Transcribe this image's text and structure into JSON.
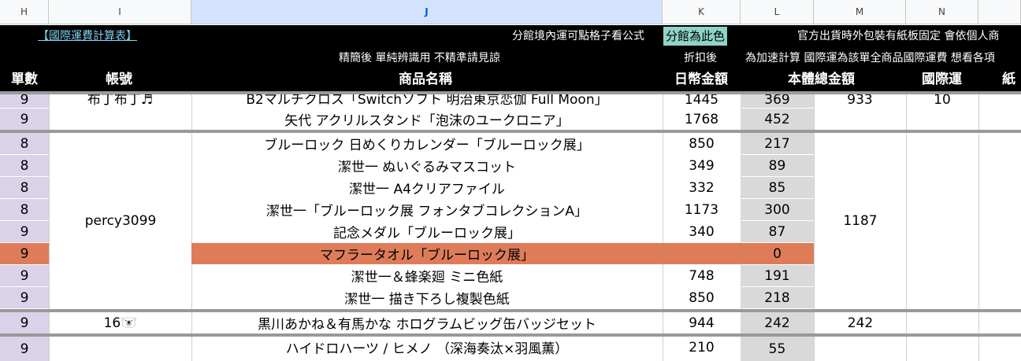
{
  "columns": [
    "H",
    "I",
    "J",
    "K",
    "L",
    "M",
    "N"
  ],
  "header": {
    "link_title": "【國際運費計算表】",
    "formula_note": "分館境內運可點格子看公式",
    "branch_color_label": "分館為此色",
    "packaging_note": "官方出貨時外包裝有紙板固定 會依個人商",
    "simplified_note": "精簡後 單純辨識用 不精準請見諒",
    "discount_note": "折扣後",
    "accel_note": "為加速計算 國際運為該單全商品國際運費 想看各項",
    "labels": {
      "qty": "單數",
      "account": "帳號",
      "product": "商品名稱",
      "jpy": "日幣金額",
      "total": "本體總金額",
      "intl": "國際運",
      "paper": "紙"
    }
  },
  "rows": [
    {
      "h": "9",
      "j": "B2マルチクロス「Switchソフト 明治東京恋伽 Full Moon」",
      "k": "1445",
      "l": "369"
    },
    {
      "h": "9",
      "j": "矢代 アクリルスタンド「泡沫のユークロニア」",
      "k": "1768",
      "l": "452"
    },
    {
      "h": "8",
      "j": "ブルーロック 日めくりカレンダー「ブルーロック展」",
      "k": "850",
      "l": "217"
    },
    {
      "h": "8",
      "j": "潔世一 ぬいぐるみマスコット",
      "k": "349",
      "l": "89"
    },
    {
      "h": "8",
      "j": "潔世一 A4クリアファイル",
      "k": "332",
      "l": "85"
    },
    {
      "h": "8",
      "j": "潔世一「ブルーロック展 フォンタブコレクションA」",
      "k": "1173",
      "l": "300"
    },
    {
      "h": "9",
      "j": "記念メダル「ブルーロック展」",
      "k": "340",
      "l": "87"
    },
    {
      "h": "9",
      "j": "マフラータオル「ブルーロック展」",
      "k": "",
      "l": "0"
    },
    {
      "h": "9",
      "j": "潔世一＆蜂楽廻 ミニ色紙",
      "k": "748",
      "l": "191"
    },
    {
      "h": "9",
      "j": "潔世一 描き下ろし複製色紙",
      "k": "850",
      "l": "218"
    },
    {
      "h": "9",
      "j": "黒川あかね＆有馬かな ホログラムビッグ缶バッジセット",
      "k": "944",
      "l": "242"
    },
    {
      "h": "9",
      "j": "ハイドロハーツ / ヒメノ （深海奏汰×羽風薫）",
      "k": "210",
      "l": "55"
    }
  ],
  "groups": {
    "g1": {
      "account": "布丁布丁♬",
      "m": "933",
      "n": "10"
    },
    "g2": {
      "account": "percy3099",
      "m": "1187"
    },
    "g3": {
      "account": "16🐻‍❄️",
      "m": "242"
    }
  },
  "colors": {
    "purple": "#d9d2e9",
    "gray": "#d9d9d9",
    "orange": "#de7c5a",
    "teal": "#8fd3c9"
  }
}
